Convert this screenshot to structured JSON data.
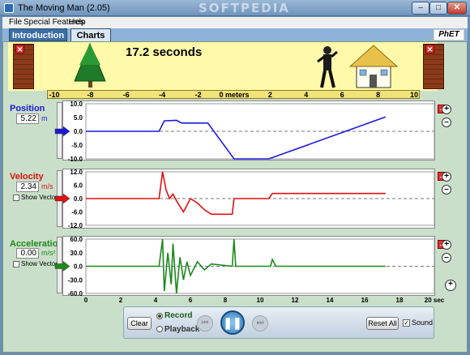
{
  "window": {
    "title": "The Moving Man (2.05)",
    "watermark": "SOFTPEDIA"
  },
  "menu": [
    "File",
    "Special Features",
    "Help"
  ],
  "tabs": {
    "intro": "Introduction",
    "charts": "Charts"
  },
  "logo": "PhET",
  "scene": {
    "time_display": "17.2 seconds",
    "ruler_ticks": [
      "-10",
      "-8",
      "-6",
      "-4",
      "-2",
      "0 meters",
      "2",
      "4",
      "6",
      "8",
      "10"
    ]
  },
  "position": {
    "label": "Position",
    "value": "5.22",
    "unit": "m",
    "y_ticks": [
      "10.0",
      "5.0",
      "0.0",
      "-5.0",
      "-10.0"
    ]
  },
  "velocity": {
    "label": "Velocity",
    "value": "2.34",
    "unit": "m/s",
    "show_vector": "Show Vector",
    "y_ticks": [
      "12.0",
      "6.0",
      "0.0",
      "-6.0",
      "-12.0"
    ]
  },
  "acceleration": {
    "label": "Acceleration",
    "value": "0.00",
    "unit": "m/s²",
    "show_vector": "Show Vector",
    "y_ticks": [
      "60.0",
      "30.0",
      "0.0",
      "-30.0",
      "-60.0"
    ]
  },
  "time_axis": {
    "ticks": [
      "0",
      "2",
      "4",
      "6",
      "8",
      "10",
      "12",
      "14",
      "16",
      "18",
      "20 sec"
    ]
  },
  "controls": {
    "clear": "Clear",
    "record": "Record",
    "playback": "Playback",
    "reset_all": "Reset All",
    "sound": "Sound"
  },
  "colors": {
    "position": "#1a1adb",
    "velocity": "#e01010",
    "acceleration": "#1a8a1a"
  }
}
